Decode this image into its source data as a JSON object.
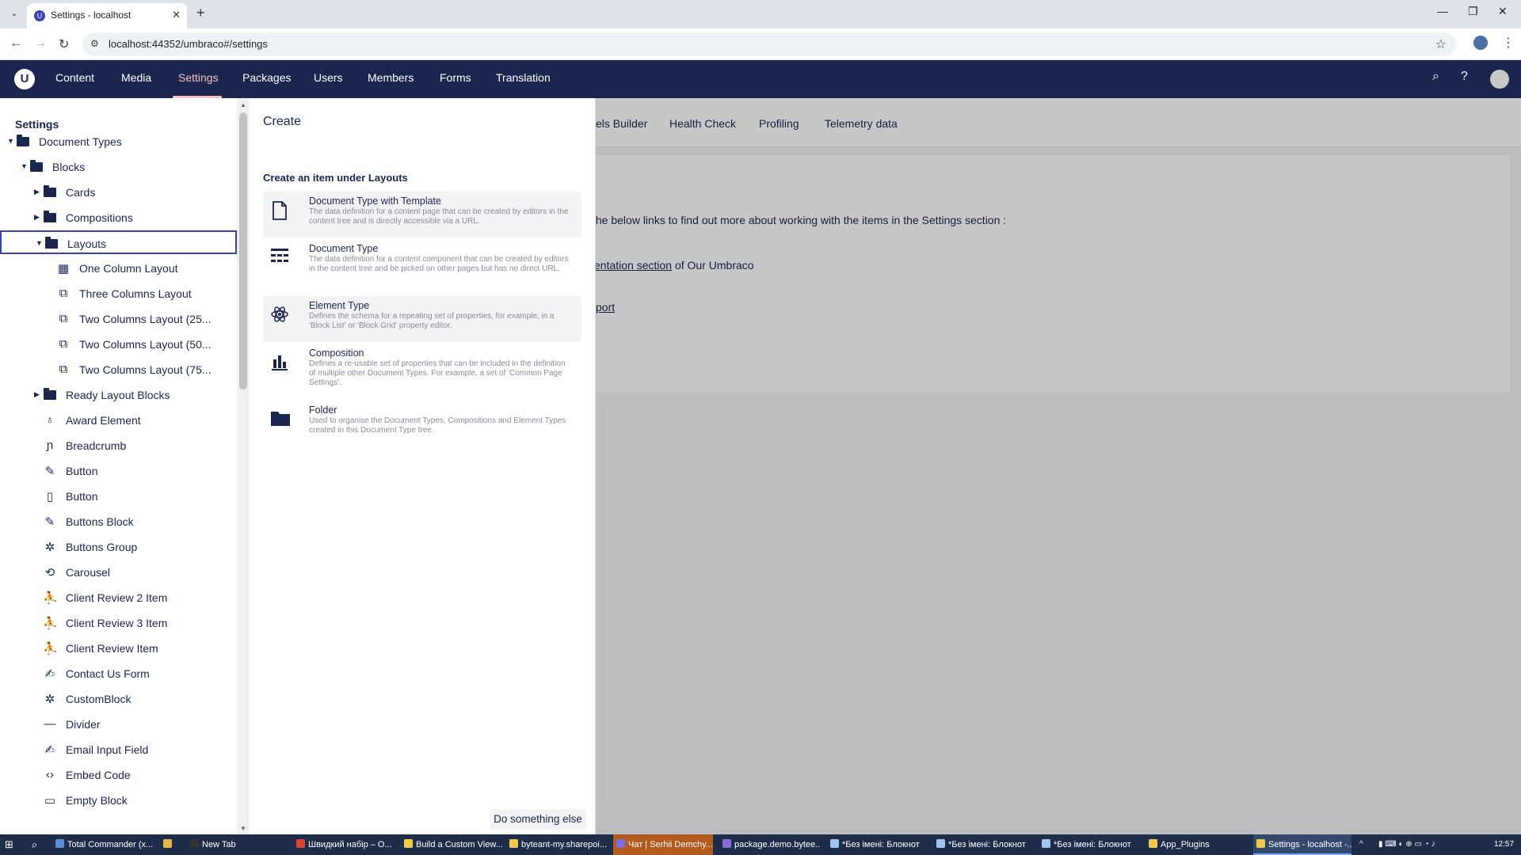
{
  "browser": {
    "tab_title": "Settings - localhost",
    "url": "localhost:44352/umbraco#/settings"
  },
  "header": {
    "sections": [
      "Content",
      "Media",
      "Settings",
      "Packages",
      "Users",
      "Members",
      "Forms",
      "Translation"
    ],
    "active_section": "Settings"
  },
  "tree": {
    "heading": "Settings",
    "items": [
      {
        "label": "Document Types",
        "icon": "folder-icon",
        "level": 0,
        "caret": "down"
      },
      {
        "label": "Blocks",
        "icon": "folder-icon",
        "level": 1,
        "caret": "down"
      },
      {
        "label": "Cards",
        "icon": "folder-icon",
        "level": 2,
        "caret": "right"
      },
      {
        "label": "Compositions",
        "icon": "folder-icon",
        "level": 2,
        "caret": "right"
      },
      {
        "label": "Layouts",
        "icon": "folder-icon",
        "level": 2,
        "caret": "down",
        "selected": true
      },
      {
        "label": "One Column Layout",
        "icon": "calculator-icon",
        "level": 3
      },
      {
        "label": "Three Columns Layout",
        "icon": "book-icon",
        "level": 3
      },
      {
        "label": "Two Columns Layout (25...",
        "icon": "book-icon",
        "level": 3
      },
      {
        "label": "Two Columns Layout (50...",
        "icon": "book-icon",
        "level": 3
      },
      {
        "label": "Two Columns Layout (75...",
        "icon": "book-icon",
        "level": 3
      },
      {
        "label": "Ready Layout Blocks",
        "icon": "folder-icon",
        "level": 2,
        "caret": "right"
      },
      {
        "label": "Award Element",
        "icon": "award-icon",
        "level": 2
      },
      {
        "label": "Breadcrumb",
        "icon": "breadcrumb-icon",
        "level": 2
      },
      {
        "label": "Button",
        "icon": "brush-icon",
        "level": 2
      },
      {
        "label": "Button",
        "icon": "document-icon",
        "level": 2
      },
      {
        "label": "Buttons Block",
        "icon": "brush-icon",
        "level": 2
      },
      {
        "label": "Buttons Group",
        "icon": "atom-icon",
        "level": 2
      },
      {
        "label": "Carousel",
        "icon": "sync-icon",
        "level": 2
      },
      {
        "label": "Client Review 2 Item",
        "icon": "user-icon",
        "level": 2
      },
      {
        "label": "Client Review 3 Item",
        "icon": "user-icon",
        "level": 2
      },
      {
        "label": "Client Review Item",
        "icon": "user-icon",
        "level": 2
      },
      {
        "label": "Contact Us Form",
        "icon": "edit-icon",
        "level": 2
      },
      {
        "label": "CustomBlock",
        "icon": "atom-icon",
        "level": 2
      },
      {
        "label": "Divider",
        "icon": "minus-icon",
        "level": 2
      },
      {
        "label": "Email Input Field",
        "icon": "edit-icon",
        "level": 2
      },
      {
        "label": "Embed Code",
        "icon": "code-icon",
        "level": 2
      },
      {
        "label": "Empty Block",
        "icon": "square-icon",
        "level": 2
      }
    ]
  },
  "dashboard": {
    "tabs": [
      "els Builder",
      "Health Check",
      "Profiling",
      "Telemetry data"
    ],
    "line1": "the below links to find out more about working with the items in the Settings section :",
    "line2_link": "entation section",
    "line2_rest": " of Our Umbraco",
    "line3_link": "port"
  },
  "create": {
    "title": "Create",
    "subtitle": "Create an item under Layouts",
    "items": [
      {
        "name": "Document Type with Template",
        "desc": "The data definition for a content page that can be created by editors in the content tree and is directly accessible via a URL.",
        "icon": "document-icon"
      },
      {
        "name": "Document Type",
        "desc": "The data definition for a content component that can be created by editors in the content tree and be picked on other pages but has no direct URL.",
        "icon": "grid-icon"
      },
      {
        "name": "Element Type",
        "desc": "Defines the schema for a repeating set of properties, for example, in a 'Block List' or 'Block Grid' property editor.",
        "icon": "atom-icon"
      },
      {
        "name": "Composition",
        "desc": "Defines a re-usable set of properties that can be included in the definition of multiple other Document Types. For example, a set of 'Common Page Settings'.",
        "icon": "composition-icon"
      },
      {
        "name": "Folder",
        "desc": "Used to organise the Document Types, Compositions and Element Types created in this Document Type tree.",
        "icon": "folder-icon"
      }
    ],
    "footer_button": "Do something else"
  },
  "taskbar": {
    "items": [
      "Total Commander (x...",
      "New Tab",
      "Швидкий набір – О...",
      "Build a Custom View...",
      "byteant-my.sharepoi...",
      "Чат | Serhii Demchy...",
      "package.demo.bytee...",
      "*Без імені: Блокнот",
      "*Без імені: Блокнот",
      "*Без імені: Блокнот",
      "App_Plugins",
      "Settings - localhost -..."
    ],
    "time": "12:57"
  }
}
